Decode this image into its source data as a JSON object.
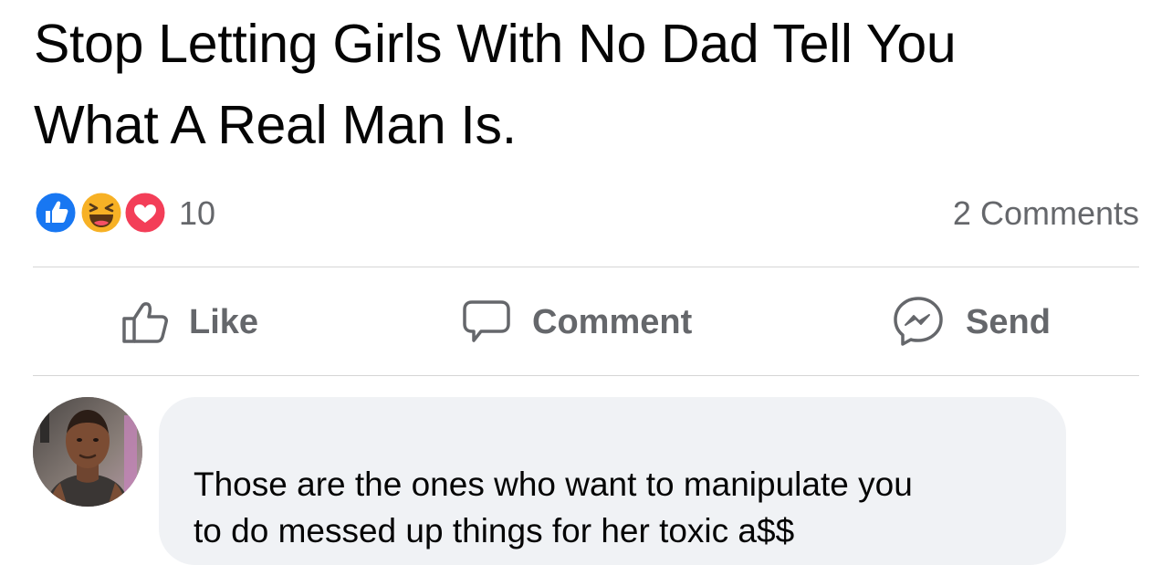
{
  "post": {
    "text_line_1": "Stop Letting Girls With No Dad Tell You",
    "text_line_2": "What A Real Man Is."
  },
  "reactions": {
    "icons": [
      "like-reaction-icon",
      "haha-reaction-icon",
      "love-reaction-icon"
    ],
    "count": "10",
    "comments_count": "2 Comments"
  },
  "actions": {
    "like_label": "Like",
    "comment_label": "Comment",
    "send_label": "Send"
  },
  "comment": {
    "text_line_1": "Those are the ones who want to manipulate you",
    "text_line_2": "to do messed up things for her toxic a$$"
  },
  "colors": {
    "like_blue": "#1877f2",
    "haha_yellow": "#f7b125",
    "love_red": "#f33e58",
    "muted_text": "#65676b",
    "bubble_bg": "#f0f2f5"
  }
}
